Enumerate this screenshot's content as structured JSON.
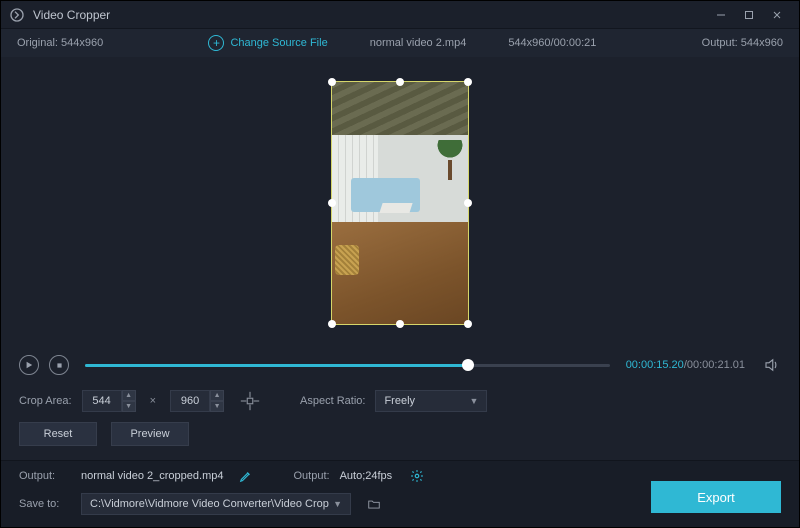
{
  "titlebar": {
    "title": "Video Cropper"
  },
  "info": {
    "original_label": "Original:",
    "original_dims": "544x960",
    "change_source_label": "Change Source File",
    "filename": "normal video 2.mp4",
    "dims_duration": "544x960/00:00:21",
    "output_label": "Output:",
    "output_dims": "544x960"
  },
  "transport": {
    "current_time": "00:00:15.20",
    "total_time": "00:00:21.01"
  },
  "crop": {
    "area_label": "Crop Area:",
    "width": "544",
    "height": "960",
    "aspect_label": "Aspect Ratio:",
    "aspect_value": "Freely"
  },
  "buttons": {
    "reset": "Reset",
    "preview": "Preview",
    "export": "Export"
  },
  "footer": {
    "output_label": "Output:",
    "output_filename": "normal video 2_cropped.mp4",
    "output_format_label": "Output:",
    "output_format_value": "Auto;24fps",
    "saveto_label": "Save to:",
    "saveto_path": "C:\\Vidmore\\Vidmore Video Converter\\Video Crop"
  }
}
